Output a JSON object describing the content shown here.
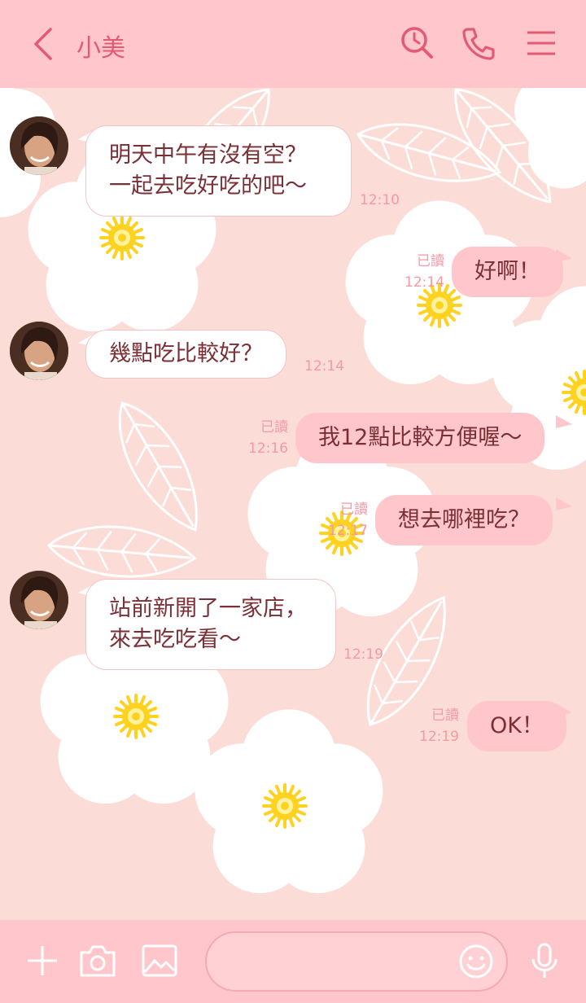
{
  "header": {
    "title": "小美",
    "icons": [
      "back-icon",
      "search-icon",
      "phone-icon",
      "menu-icon"
    ]
  },
  "messages": [
    {
      "side": "in",
      "lines": [
        "明天中午有沒有空？",
        "一起去吃好吃的吧～"
      ],
      "time": "12:10"
    },
    {
      "side": "out",
      "text": "好啊！",
      "read": "已讀",
      "time": "12:14"
    },
    {
      "side": "in",
      "lines": [
        "幾點吃比較好？"
      ],
      "time": "12:14"
    },
    {
      "side": "out",
      "text": "我12點比較方便喔～",
      "read": "已讀",
      "time": "12:16"
    },
    {
      "side": "out",
      "text": "想去哪裡吃？",
      "read": "已讀",
      "time": "12:17"
    },
    {
      "side": "in",
      "lines": [
        "站前新開了一家店，",
        "來去吃吃看～"
      ],
      "time": "12:19"
    },
    {
      "side": "out",
      "text": "OK！",
      "read": "已讀",
      "time": "12:19"
    }
  ],
  "composer": {
    "placeholder": "",
    "icons": [
      "plus-icon",
      "camera-icon",
      "image-icon",
      "emoji-icon",
      "microphone-icon"
    ]
  },
  "colors": {
    "header_bg": "#ffc7cc",
    "accent": "#e35a75",
    "background": "#fbdcd6",
    "bubble_out": "#ffc7cc",
    "bubble_in": "#ffffff",
    "text": "#7a2f35",
    "meta_text": "#f39aa6",
    "flower_center": "#ffd21f"
  }
}
